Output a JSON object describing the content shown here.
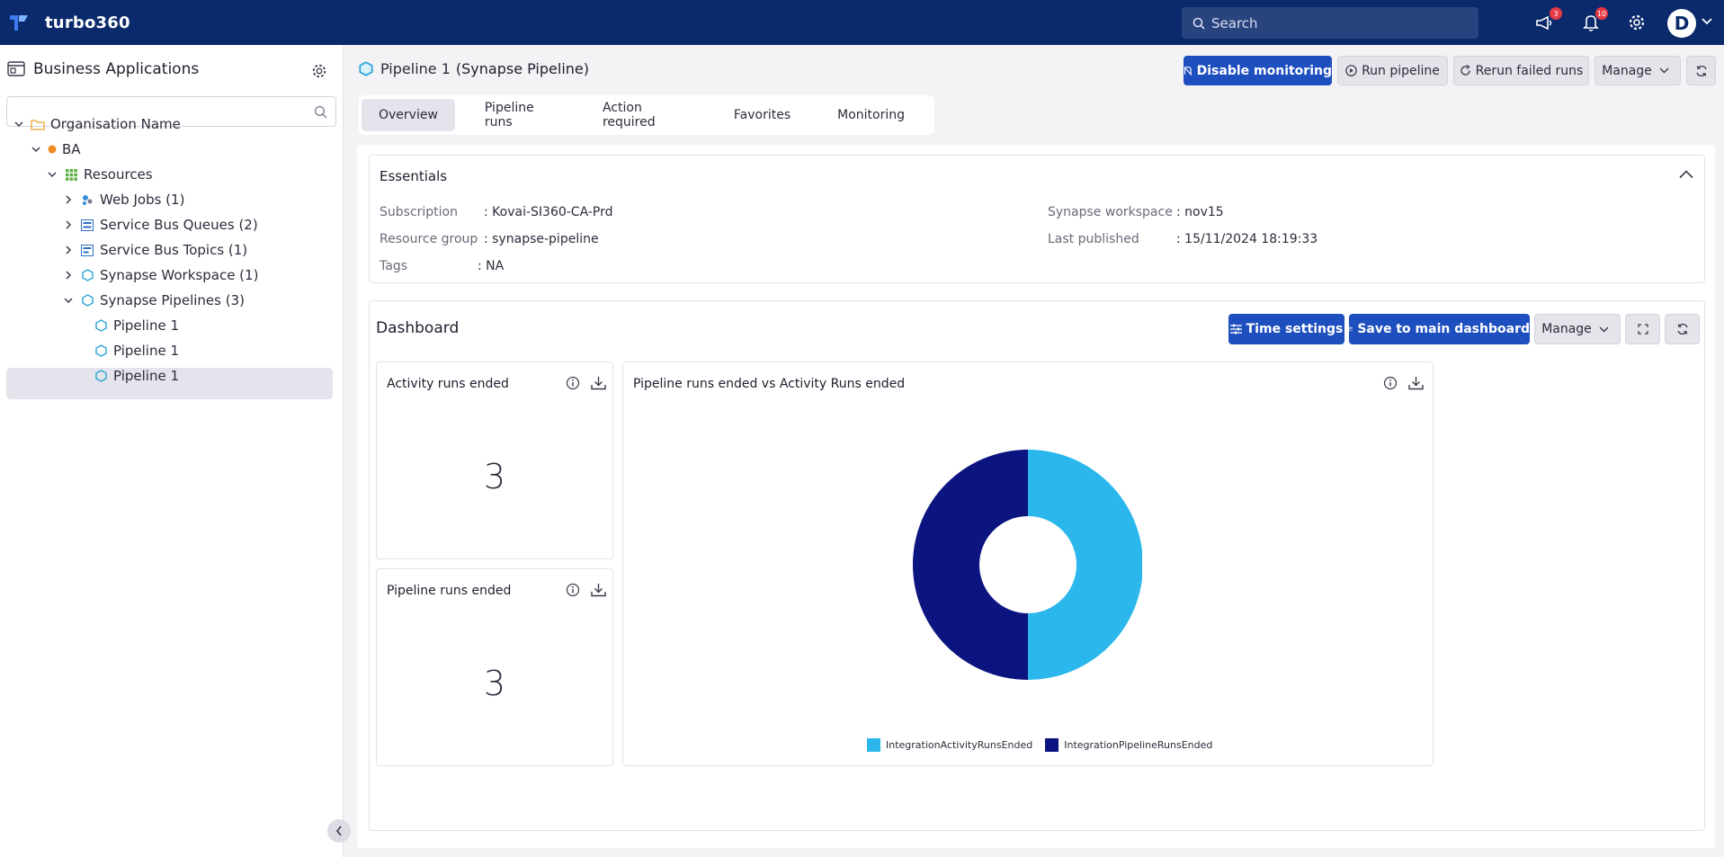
{
  "topbar": {
    "brand": "turbo360",
    "search_placeholder": "Search",
    "announcements_count": "3",
    "notifications_count": "10",
    "avatar_initial": "D"
  },
  "sidebar": {
    "title": "Business Applications",
    "search_value": "",
    "tree": [
      {
        "label": "Organisation Name",
        "icon": "folder-icon"
      },
      {
        "label": "BA",
        "icon": "status-dot-icon"
      },
      {
        "label": "Resources",
        "icon": "grid-icon"
      },
      {
        "label": "Web Jobs (1)",
        "icon": "webjobs-icon"
      },
      {
        "label": "Service Bus Queues (2)",
        "icon": "queue-icon"
      },
      {
        "label": "Service Bus Topics (1)",
        "icon": "topic-icon"
      },
      {
        "label": "Synapse Workspace (1)",
        "icon": "synapse-icon"
      },
      {
        "label": "Synapse Pipelines (3)",
        "icon": "synapse-icon"
      },
      {
        "label": "Pipeline 1",
        "icon": "synapse-icon"
      },
      {
        "label": "Pipeline 1",
        "icon": "synapse-icon"
      },
      {
        "label": "Pipeline 1",
        "icon": "synapse-icon"
      }
    ]
  },
  "header": {
    "title": "Pipeline 1",
    "subtitle": "(Synapse Pipeline)",
    "buttons": {
      "disable_monitoring": "Disable monitoring",
      "run_pipeline": "Run pipeline",
      "rerun_failed": "Rerun failed runs",
      "manage": "Manage"
    }
  },
  "tabs": [
    "Overview",
    "Pipeline runs",
    "Action required",
    "Favorites",
    "Monitoring"
  ],
  "essentials": {
    "title": "Essentials",
    "fields": {
      "subscription_label": "Subscription",
      "subscription_value": ": Kovai-SI360-CA-Prd",
      "resource_group_label": "Resource group",
      "resource_group_value": ": synapse-pipeline",
      "tags_label": "Tags",
      "tags_value": ": NA",
      "workspace_label": "Synapse workspace",
      "workspace_value": ": nov15",
      "published_label": "Last published",
      "published_value": ": 15/11/2024 18:19:33"
    }
  },
  "dashboard": {
    "title": "Dashboard",
    "buttons": {
      "time_settings": "Time settings",
      "save_main": "Save to main dashboard",
      "manage": "Manage"
    },
    "cards": {
      "activity_runs": {
        "title": "Activity runs ended",
        "value": "3"
      },
      "pipeline_runs": {
        "title": "Pipeline runs ended",
        "value": "3"
      },
      "donut": {
        "title": "Pipeline runs ended vs Activity Runs ended"
      }
    }
  },
  "colors": {
    "topbar": "#0b2a6b",
    "primary": "#1e4fbf",
    "series_activity": "#2bb7ec",
    "series_pipeline": "#0c1480"
  },
  "chart_data": {
    "type": "pie",
    "title": "Pipeline runs ended vs Activity Runs ended",
    "categories": [
      "IntegrationActivityRunsEnded",
      "IntegrationPipelineRunsEnded"
    ],
    "values": [
      3,
      3
    ],
    "colors": [
      "#2bb7ec",
      "#0c1480"
    ],
    "donut": true,
    "legend": "bottom"
  }
}
